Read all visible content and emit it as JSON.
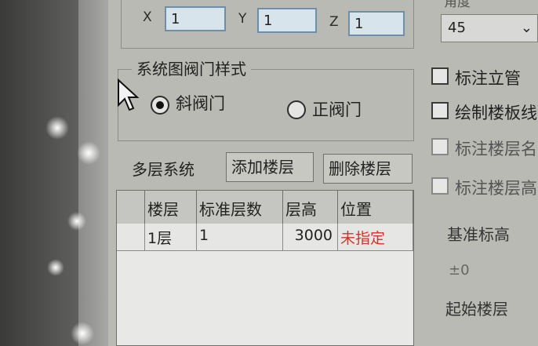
{
  "coords": {
    "x_label": "X",
    "x_value": "1",
    "y_label": "Y",
    "y_value": "1",
    "z_label": "Z",
    "z_value": "1"
  },
  "angle": {
    "label": "角度",
    "value": "45"
  },
  "valve_style": {
    "title": "系统图阀门样式",
    "options": [
      {
        "label": "斜阀门",
        "selected": true
      },
      {
        "label": "正阀门",
        "selected": false
      }
    ]
  },
  "multi_floor": {
    "label": "多层系统",
    "add_button": "添加楼层",
    "delete_button": "删除楼层"
  },
  "floor_table": {
    "columns": [
      "楼层",
      "标准层数",
      "层高",
      "位置"
    ],
    "rows": [
      {
        "floor": "1层",
        "std_count": "1",
        "height": "3000",
        "position": "未指定"
      }
    ]
  },
  "options": {
    "mark_riser": "标注立管",
    "draw_floor_line": "绘制楼板线",
    "mark_floor_name": "标注楼层名",
    "mark_floor_height": "标注楼层高"
  },
  "base_elevation": {
    "label": "基准标高",
    "value": "±0"
  },
  "start_floor": {
    "label": "起始楼层"
  },
  "colors": {
    "accent_red": "#d2322d",
    "panel": "#b9bab4"
  }
}
